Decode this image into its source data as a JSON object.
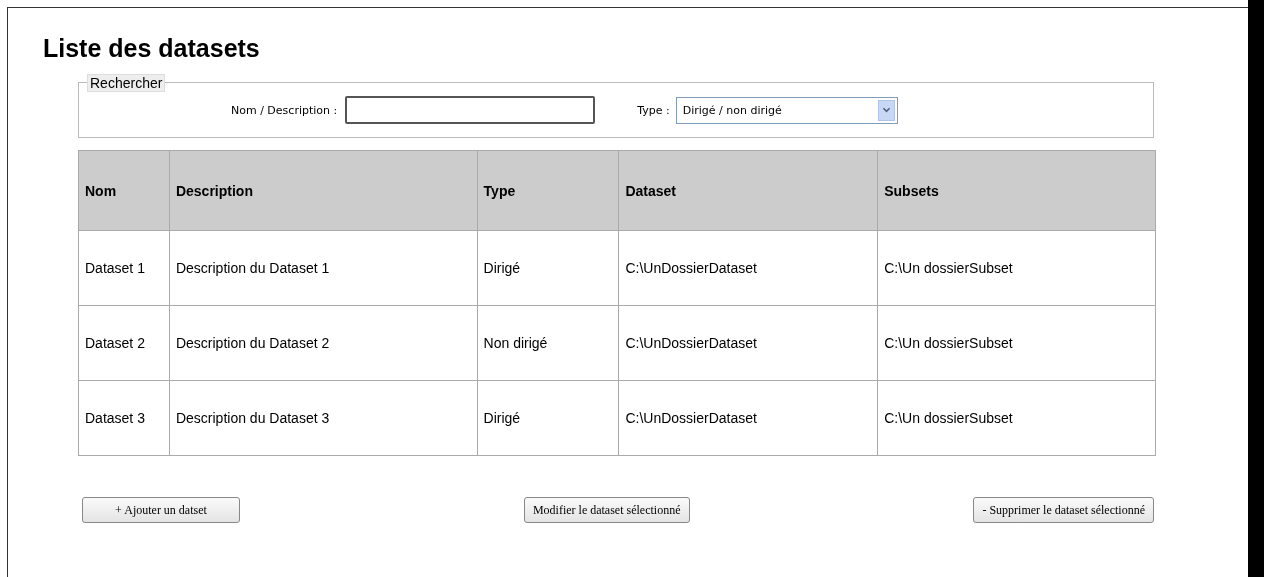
{
  "title": "Liste des datasets",
  "search": {
    "legend": "Rechercher",
    "name_label": "Nom / Description :",
    "type_label": "Type :",
    "type_value": "Dirigé / non dirigé"
  },
  "table": {
    "columns": [
      "Nom",
      "Description",
      "Type",
      "Dataset",
      "Subsets"
    ],
    "rows": [
      [
        "Dataset 1",
        "Description du Dataset 1",
        "Dirigé",
        "C:\\UnDossierDataset",
        "C:\\Un dossierSubset"
      ],
      [
        "Dataset 2",
        "Description du Dataset 2",
        "Non dirigé",
        "C:\\UnDossierDataset",
        "C:\\Un dossierSubset"
      ],
      [
        "Dataset 3",
        "Description du Dataset 3",
        "Dirigé",
        "C:\\UnDossierDataset",
        "C:\\Un dossierSubset"
      ]
    ]
  },
  "buttons": [
    "+ Ajouter un datset",
    "Modifier le dataset sélectionné",
    "- Supprimer le dataset sélectionné"
  ]
}
